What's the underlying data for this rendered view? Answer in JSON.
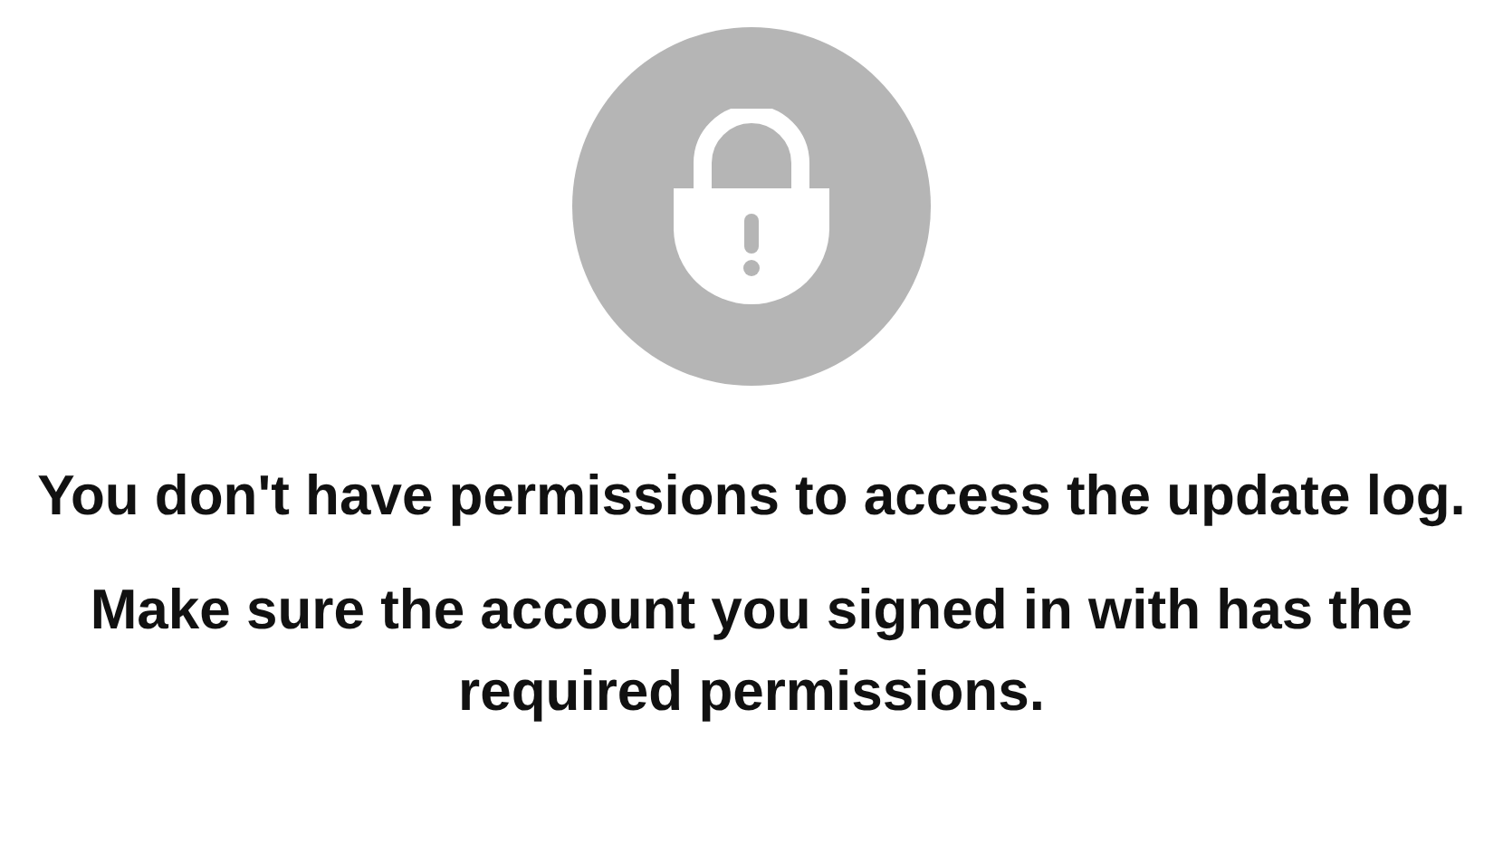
{
  "message": {
    "title": "You don't have permissions to access the update log.",
    "detail": "Make sure the account you signed in with has the required permissions."
  }
}
